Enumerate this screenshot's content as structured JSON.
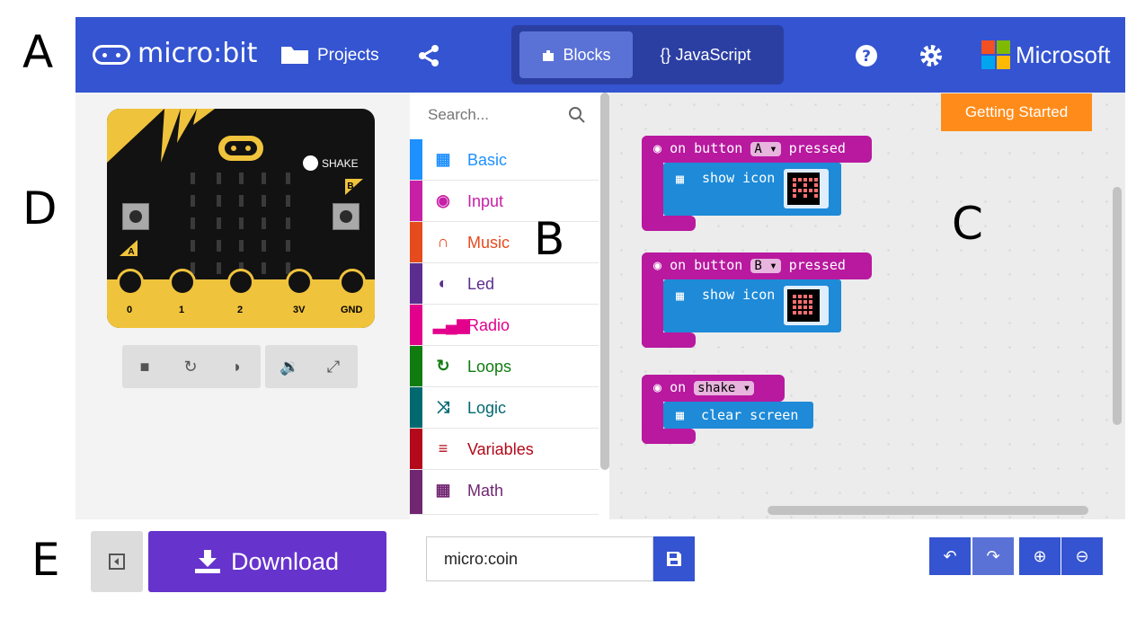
{
  "annotations": {
    "a": "A",
    "b": "B",
    "c": "C",
    "d": "D",
    "e": "E"
  },
  "header": {
    "logo_text": "micro:bit",
    "projects_label": "Projects",
    "tabs": [
      {
        "label": "Blocks",
        "active": true
      },
      {
        "label": "{} JavaScript",
        "active": false
      }
    ],
    "brand": "Microsoft",
    "color": "#3454d1"
  },
  "simulator": {
    "shake_label": "SHAKE",
    "button_a": "A",
    "button_b": "B",
    "pins": [
      "0",
      "1",
      "2",
      "3V",
      "GND"
    ]
  },
  "toolbox": {
    "search_placeholder": "Search...",
    "categories": [
      {
        "label": "Basic",
        "icon": "grid-icon",
        "color": "#1e90ff"
      },
      {
        "label": "Input",
        "icon": "target-icon",
        "color": "#c71fa6"
      },
      {
        "label": "Music",
        "icon": "headphones-icon",
        "color": "#e64b1e"
      },
      {
        "label": "Led",
        "icon": "toggle-icon",
        "color": "#5c2d91"
      },
      {
        "label": "Radio",
        "icon": "signal-icon",
        "color": "#e3008c"
      },
      {
        "label": "Loops",
        "icon": "loop-icon",
        "color": "#107c10"
      },
      {
        "label": "Logic",
        "icon": "shuffle-icon",
        "color": "#006970"
      },
      {
        "label": "Variables",
        "icon": "list-icon",
        "color": "#b4091b"
      },
      {
        "label": "Math",
        "icon": "calculator-icon",
        "color": "#712672"
      }
    ]
  },
  "workspace": {
    "getting_started": "Getting Started",
    "blocks": [
      {
        "event_pre": "on button",
        "dropdown": "A",
        "event_post": "pressed",
        "statement": "show icon"
      },
      {
        "event_pre": "on button",
        "dropdown": "B",
        "event_post": "pressed",
        "statement": "show icon"
      },
      {
        "event_pre": "on",
        "dropdown": "shake",
        "event_post": "",
        "statement": "clear screen"
      }
    ]
  },
  "footer": {
    "download_label": "Download",
    "project_name": "micro:coin"
  }
}
